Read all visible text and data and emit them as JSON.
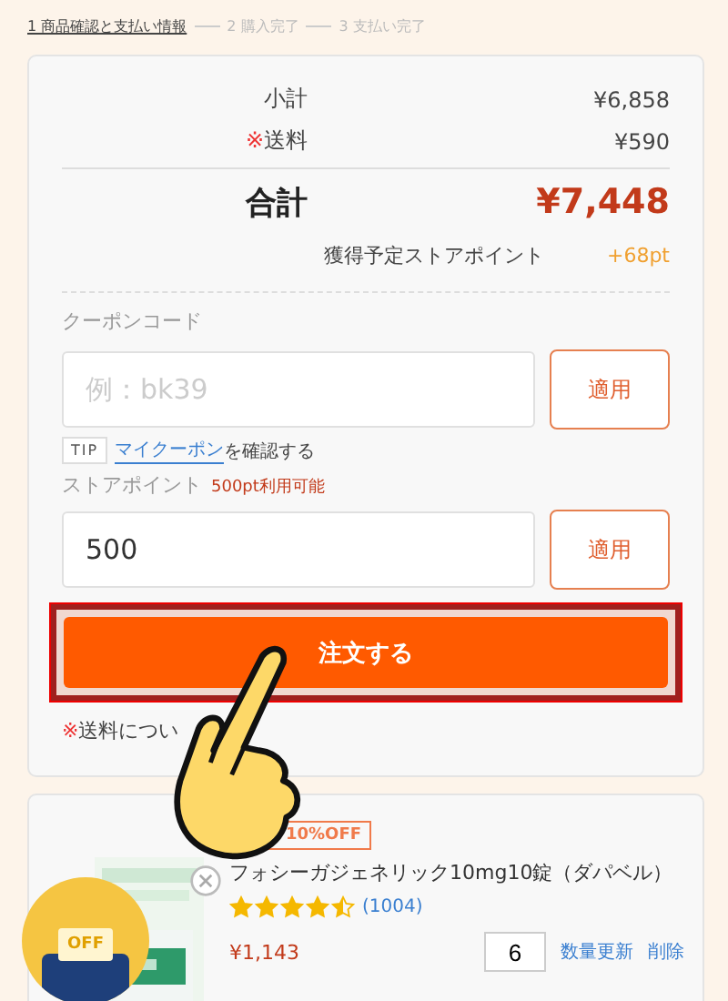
{
  "steps": [
    {
      "label": "1 商品確認と支払い情報",
      "selected": true
    },
    {
      "label": "2 購入完了",
      "selected": false
    },
    {
      "label": "3 支払い完了",
      "selected": false
    }
  ],
  "summary": {
    "rows": [
      {
        "label": "小計",
        "mark": "",
        "value": "¥6,858"
      },
      {
        "label": "送料",
        "mark": "※",
        "value": "¥590"
      }
    ],
    "total_label": "合計",
    "total_value": "¥7,448",
    "points_label": "獲得予定ストアポイント",
    "points_value": "+68pt"
  },
  "coupon": {
    "label": "クーポンコード",
    "placeholder": "例：bk39",
    "button": "適用",
    "tip_badge": "TIP",
    "tip_link": "マイクーポン",
    "tip_text": "を確認する"
  },
  "store_points": {
    "label": "ストアポイント",
    "available": "500pt利用可能",
    "value": "500",
    "button": "適用"
  },
  "order_button": "注文する",
  "shipping_note": {
    "mark": "※",
    "text": "送料につい"
  },
  "product": {
    "discount_badge": "10%OFF",
    "name": "フォシーガジェネリック10mg10錠（ダパベル）",
    "stars": 4.5,
    "reviews": "(1004)",
    "price": "¥1,143",
    "quantity": "6",
    "update_link": "数量更新",
    "delete_link": "削除"
  },
  "floating_badge": {
    "text": "OFF"
  }
}
